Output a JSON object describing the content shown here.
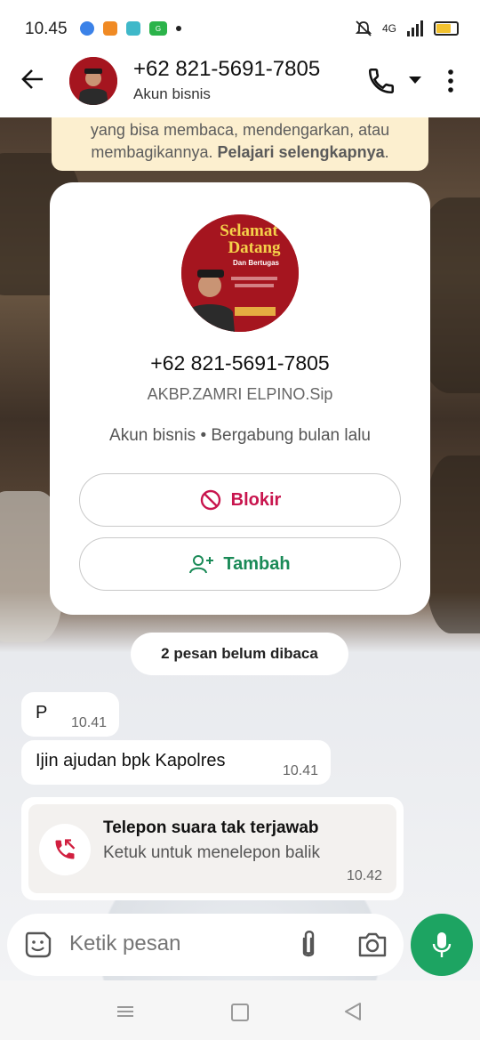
{
  "status_bar": {
    "time": "10.45",
    "network": "4G"
  },
  "header": {
    "contact_phone": "+62 821-5691-7805",
    "subtitle": "Akun bisnis"
  },
  "avatar_text": {
    "line1": "Selamat",
    "line2": "Datang",
    "line3": "Dan Bertugas"
  },
  "notice": {
    "line1": "yang bisa membaca, mendengarkan, atau",
    "line2": "membagikannya.",
    "link": "Pelajari selengkapnya"
  },
  "contact_card": {
    "phone": "+62 821-5691-7805",
    "name": "AKBP.ZAMRI ELPINO.Sip",
    "meta": "Akun bisnis • Bergabung bulan lalu",
    "block_label": "Blokir",
    "add_label": "Tambah"
  },
  "unread_label": "2 pesan belum dibaca",
  "messages": [
    {
      "text": "P",
      "time": "10.41"
    },
    {
      "text": "Ijin ajudan bpk Kapolres",
      "time": "10.41"
    }
  ],
  "missed_call": {
    "title": "Telepon suara tak terjawab",
    "subtitle": "Ketuk untuk menelepon balik",
    "time": "10.42"
  },
  "composer": {
    "placeholder": "Ketik pesan"
  },
  "colors": {
    "accent_green": "#1da462",
    "block_red": "#c8154e",
    "add_green": "#1a8a57",
    "notice_bg": "#fcefcf"
  }
}
